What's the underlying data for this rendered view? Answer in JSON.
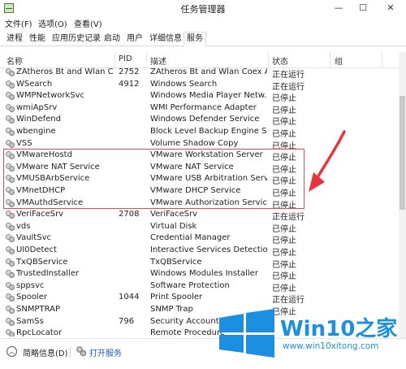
{
  "window": {
    "title": "任务管理器",
    "min_glyph": "—",
    "max_glyph": "☐",
    "close_glyph": "✕"
  },
  "menu": [
    "文件(F)",
    "选项(O)",
    "查看(V)"
  ],
  "tabs": [
    "进程",
    "性能",
    "应用历史记录",
    "启动",
    "用户",
    "详细信息",
    "服务"
  ],
  "active_tab": "服务",
  "columns": {
    "name": "名称",
    "pid": "PID",
    "desc": "描述",
    "status": "状态",
    "group": "组"
  },
  "rows": [
    {
      "name": "ZAtheros Bt and Wlan C...",
      "pid": "2752",
      "desc": "ZAtheros Bt and Wlan Coex A...",
      "status": "正在运行"
    },
    {
      "name": "WSearch",
      "pid": "4912",
      "desc": "Windows Search",
      "status": "正在运行"
    },
    {
      "name": "WMPNetworkSvc",
      "pid": "",
      "desc": "Windows Media Player Netw...",
      "status": "已停止"
    },
    {
      "name": "wmiApSrv",
      "pid": "",
      "desc": "WMI Performance Adapter",
      "status": "已停止"
    },
    {
      "name": "WinDefend",
      "pid": "",
      "desc": "Windows Defender Service",
      "status": "已停止"
    },
    {
      "name": "wbengine",
      "pid": "",
      "desc": "Block Level Backup Engine Se...",
      "status": "已停止"
    },
    {
      "name": "VSS",
      "pid": "",
      "desc": "Volume Shadow Copy",
      "status": "已停止"
    },
    {
      "name": "VMwareHostd",
      "pid": "",
      "desc": "VMware Workstation Server",
      "status": "已停止"
    },
    {
      "name": "VMware NAT Service",
      "pid": "",
      "desc": "VMware NAT Service",
      "status": "已停止"
    },
    {
      "name": "VMUSBArbService",
      "pid": "",
      "desc": "VMware USB Arbitration Serv...",
      "status": "已停止"
    },
    {
      "name": "VMnetDHCP",
      "pid": "",
      "desc": "VMware DHCP Service",
      "status": "已停止"
    },
    {
      "name": "VMAuthdService",
      "pid": "",
      "desc": "VMware Authorization Service",
      "status": "已停止"
    },
    {
      "name": "VeriFaceSrv",
      "pid": "2708",
      "desc": "VeriFaceSrv",
      "status": "正在运行"
    },
    {
      "name": "vds",
      "pid": "",
      "desc": "Virtual Disk",
      "status": "已停止"
    },
    {
      "name": "VaultSvc",
      "pid": "",
      "desc": "Credential Manager",
      "status": "已停止"
    },
    {
      "name": "UI0Detect",
      "pid": "",
      "desc": "Interactive Services Detection",
      "status": "已停止"
    },
    {
      "name": "TxQBService",
      "pid": "",
      "desc": "TxQBService",
      "status": "已停止"
    },
    {
      "name": "TrustedInstaller",
      "pid": "",
      "desc": "Windows Modules Installer",
      "status": "已停止"
    },
    {
      "name": "sppsvc",
      "pid": "",
      "desc": "Software Protection",
      "status": "已停止"
    },
    {
      "name": "Spooler",
      "pid": "1044",
      "desc": "Print Spooler",
      "status": "正在运行"
    },
    {
      "name": "SNMPTRAP",
      "pid": "",
      "desc": "SNMP Trap",
      "status": "已停止"
    },
    {
      "name": "SamSs",
      "pid": "796",
      "desc": "Security Accounts",
      "status": ""
    },
    {
      "name": "RpcLocator",
      "pid": "",
      "desc": "Remote Procedure",
      "status": ""
    }
  ],
  "footer": {
    "fewer_details": "简略信息(D)",
    "open_services": "打开服务"
  },
  "watermark": {
    "title": "Win10",
    "title_accent": "之家",
    "url": "www.win10xitong.com"
  },
  "colors": {
    "highlight_box": "#e04b55",
    "arrow": "#e8343f",
    "watermark": "#1c8fe0",
    "link": "#1a5fb4"
  }
}
